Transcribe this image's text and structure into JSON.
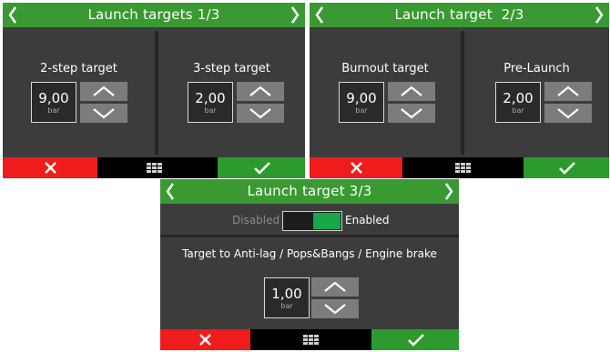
{
  "screens": [
    {
      "title": "Launch targets 1/3",
      "panels": [
        {
          "label": "2-step target",
          "value": "9,00",
          "unit": "bar"
        },
        {
          "label": "3-step target",
          "value": "2,00",
          "unit": "bar"
        }
      ]
    },
    {
      "title": "Launch target  2/3",
      "panels": [
        {
          "label": "Burnout target",
          "value": "9,00",
          "unit": "bar"
        },
        {
          "label": "Pre-Launch",
          "value": "2,00",
          "unit": "bar"
        }
      ]
    },
    {
      "title": "Launch target 3/3",
      "toggle": {
        "off_label": "Disabled",
        "on_label": "Enabled",
        "state": "enabled"
      },
      "panels": [
        {
          "label": "Target to Anti-lag / Pops&Bangs / Engine brake",
          "value": "1,00",
          "unit": "bar"
        }
      ]
    }
  ],
  "icons": {
    "nav_prev": "chevron-left-icon",
    "nav_next": "chevron-right-icon",
    "increment": "chevron-up-icon",
    "decrement": "chevron-down-icon",
    "cancel": "close-icon",
    "menu": "grid-menu-icon",
    "confirm": "checkmark-icon"
  },
  "colors": {
    "title_bar": "#3a9a32",
    "cancel": "#ee1c1c",
    "confirm": "#2c9a2c",
    "toggle_on": "#17a84a",
    "panel": "#3c3c3c"
  }
}
